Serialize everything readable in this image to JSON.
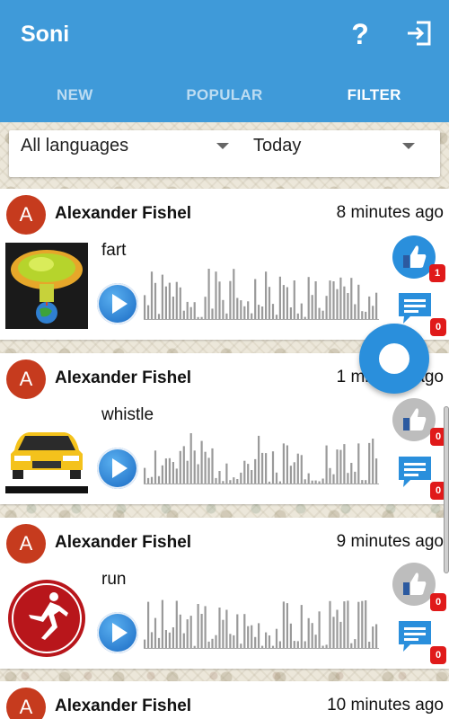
{
  "app": {
    "title": "Soni"
  },
  "toolbar": {
    "help_icon": "question-mark-icon",
    "logout_icon": "exit-icon"
  },
  "tabs": [
    {
      "label": "NEW",
      "active": false
    },
    {
      "label": "POPULAR",
      "active": false
    },
    {
      "label": "FILTER",
      "active": true
    }
  ],
  "filter": {
    "language": "All languages",
    "period": "Today"
  },
  "feed": [
    {
      "avatar_letter": "A",
      "author": "Alexander Fishel",
      "time": "8 minutes ago",
      "sound_name": "fart",
      "thumbnail": "mushroom-cloud-earth",
      "likes": "1",
      "liked": true,
      "comments": "0"
    },
    {
      "avatar_letter": "A",
      "author": "Alexander Fishel",
      "time": "1 minutes ago",
      "sound_name": "whistle",
      "thumbnail": "yellow-car",
      "likes": "0",
      "liked": false,
      "comments": "0"
    },
    {
      "avatar_letter": "A",
      "author": "Alexander Fishel",
      "time": "9 minutes ago",
      "sound_name": "run",
      "thumbnail": "runner-sign",
      "likes": "0",
      "liked": false,
      "comments": "0"
    },
    {
      "avatar_letter": "A",
      "author": "Alexander Fishel",
      "time": "10 minutes ago"
    }
  ],
  "colors": {
    "primary": "#3f9ad9",
    "avatar": "#c63b1e",
    "badge": "#e01a1a",
    "liked": "#2a8fdc",
    "unliked": "#bdbdbd"
  }
}
